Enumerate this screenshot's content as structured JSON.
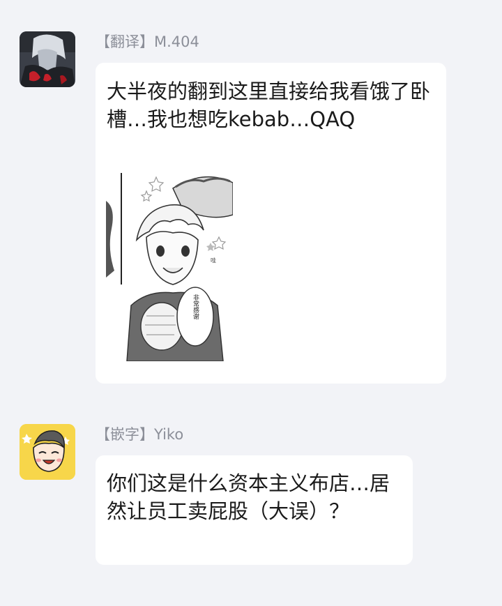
{
  "messages": [
    {
      "sender": "【翻译】M.404",
      "text": "大半夜的翻到这里直接给我看饿了卧槽…我也想吃kebab…QAQ",
      "avatar_icon": "dark-character-avatar",
      "image": {
        "icon": "manga-panel-image",
        "speech_bubble_text": "非常感谢",
        "sfx_text": "哇"
      }
    },
    {
      "sender": "【嵌字】Yiko",
      "text": "你们这是什么资本主义布店…居然让员工卖屁股（大误）？",
      "avatar_icon": "cartoon-face-avatar"
    }
  ],
  "colors": {
    "background": "#f2f3f7",
    "bubble": "#ffffff",
    "sender_text": "#8c8f99",
    "message_text": "#1a1a1a",
    "yellow_avatar": "#f7d64a"
  }
}
